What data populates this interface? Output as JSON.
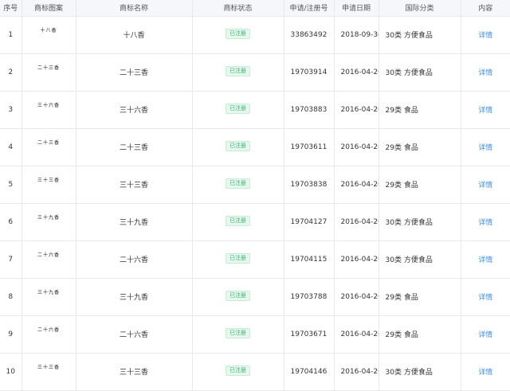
{
  "columns": {
    "idx": "序号",
    "logo": "商标图案",
    "name": "商标名称",
    "status": "商标状态",
    "regno": "申请/注册号",
    "date": "申请日期",
    "cls": "国际分类",
    "detail": "内容"
  },
  "rows": [
    {
      "idx": "1",
      "logo": "十八香",
      "name": "十八香",
      "status": "已注册",
      "regno": "33863492",
      "date": "2018-09-30",
      "cls": "30类 方便食品",
      "detail": "详情"
    },
    {
      "idx": "2",
      "logo": "二十三香",
      "name": "二十三香",
      "status": "已注册",
      "regno": "19703914",
      "date": "2016-04-20",
      "cls": "30类 方便食品",
      "detail": "详情"
    },
    {
      "idx": "3",
      "logo": "三十六香",
      "name": "三十六香",
      "status": "已注册",
      "regno": "19703883",
      "date": "2016-04-20",
      "cls": "29类 食品",
      "detail": "详情"
    },
    {
      "idx": "4",
      "logo": "二十三香",
      "name": "二十三香",
      "status": "已注册",
      "regno": "19703611",
      "date": "2016-04-20",
      "cls": "29类 食品",
      "detail": "详情"
    },
    {
      "idx": "5",
      "logo": "三十三香",
      "name": "三十三香",
      "status": "已注册",
      "regno": "19703838",
      "date": "2016-04-20",
      "cls": "29类 食品",
      "detail": "详情"
    },
    {
      "idx": "6",
      "logo": "三十九香",
      "name": "三十九香",
      "status": "已注册",
      "regno": "19704127",
      "date": "2016-04-20",
      "cls": "30类 方便食品",
      "detail": "详情"
    },
    {
      "idx": "7",
      "logo": "二十六香",
      "name": "二十六香",
      "status": "已注册",
      "regno": "19704115",
      "date": "2016-04-20",
      "cls": "30类 方便食品",
      "detail": "详情"
    },
    {
      "idx": "8",
      "logo": "三十九香",
      "name": "三十九香",
      "status": "已注册",
      "regno": "19703788",
      "date": "2016-04-20",
      "cls": "29类 食品",
      "detail": "详情"
    },
    {
      "idx": "9",
      "logo": "二十六香",
      "name": "二十六香",
      "status": "已注册",
      "regno": "19703671",
      "date": "2016-04-20",
      "cls": "29类 食品",
      "detail": "详情"
    },
    {
      "idx": "10",
      "logo": "三十三香",
      "name": "三十三香",
      "status": "已注册",
      "regno": "19704146",
      "date": "2016-04-20",
      "cls": "30类 方便食品",
      "detail": "详情"
    }
  ],
  "colors": {
    "header_bg": "#f5f7fa",
    "border": "#e8e8e8",
    "badge_text": "#3bb273",
    "badge_bg": "#e6f7ee",
    "link": "#3a8ee6"
  }
}
